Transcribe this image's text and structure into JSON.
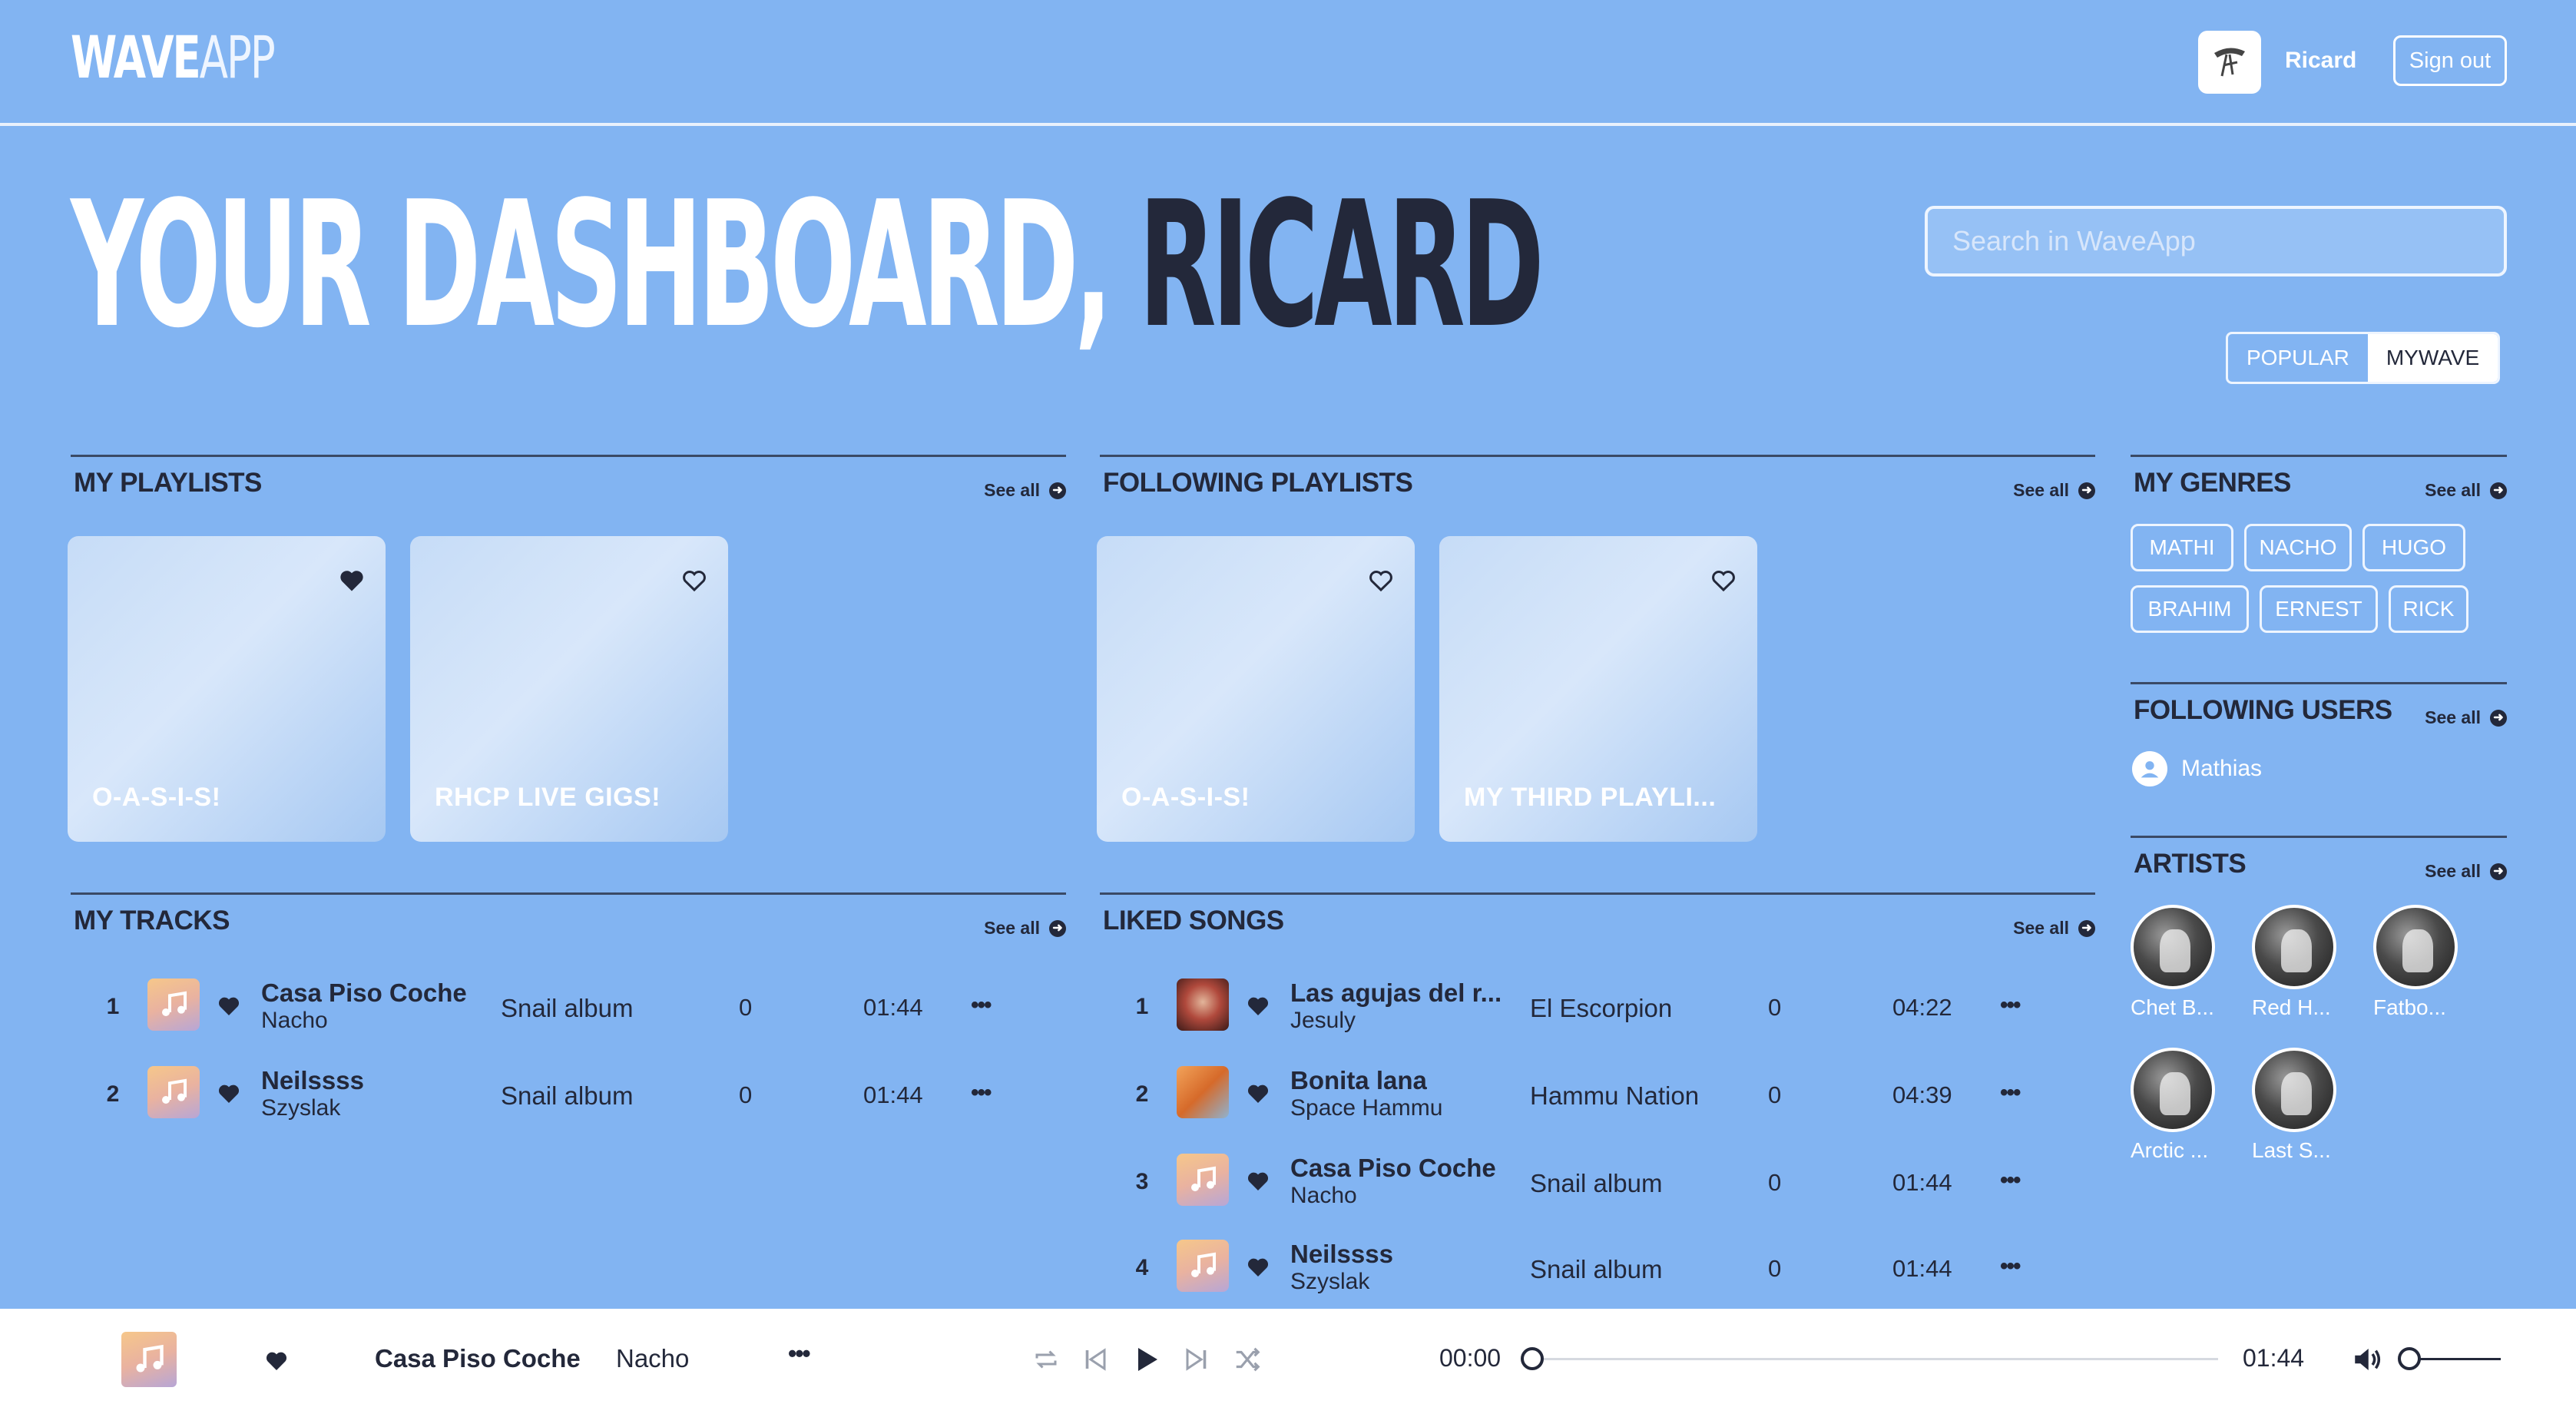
{
  "header": {
    "logo_bold": "WAVE",
    "logo_light": "APP",
    "user_name": "Ricard",
    "signout_label": "Sign out"
  },
  "hero": {
    "title_part1": "YOUR DASHBOARD, ",
    "title_part2": "RICARD"
  },
  "search": {
    "placeholder": "Search in WaveApp"
  },
  "segmented": {
    "popular": "POPULAR",
    "mywave": "MYWAVE",
    "active": "MYWAVE"
  },
  "see_all": "See all",
  "my_playlists": {
    "title": "MY PLAYLISTS",
    "items": [
      {
        "name": "O-A-S-I-S!",
        "liked": true
      },
      {
        "name": "RHCP LIVE GIGS!",
        "liked": false
      }
    ]
  },
  "following_playlists": {
    "title": "FOLLOWING PLAYLISTS",
    "items": [
      {
        "name": "O-A-S-I-S!",
        "liked": false
      },
      {
        "name": "MY THIRD PLAYLI...",
        "liked": false
      }
    ]
  },
  "my_tracks": {
    "title": "MY TRACKS",
    "rows": [
      {
        "num": "1",
        "name": "Casa Piso Coche",
        "artist": "Nacho",
        "album": "Snail album",
        "plays": "0",
        "duration": "01:44",
        "thumb": "music-note"
      },
      {
        "num": "2",
        "name": "Neilssss",
        "artist": "Szyslak",
        "album": "Snail album",
        "plays": "0",
        "duration": "01:44",
        "thumb": "music-note"
      }
    ]
  },
  "liked_songs": {
    "title": "LIKED SONGS",
    "rows": [
      {
        "num": "1",
        "name": "Las agujas del r...",
        "artist": "Jesuly",
        "album": "El Escorpion",
        "plays": "0",
        "duration": "04:22",
        "thumb": "photo-red"
      },
      {
        "num": "2",
        "name": "Bonita lana",
        "artist": "Space Hammu",
        "album": "Hammu Nation",
        "plays": "0",
        "duration": "04:39",
        "thumb": "photo-orange"
      },
      {
        "num": "3",
        "name": "Casa Piso Coche",
        "artist": "Nacho",
        "album": "Snail album",
        "plays": "0",
        "duration": "01:44",
        "thumb": "music-note"
      },
      {
        "num": "4",
        "name": "Neilssss",
        "artist": "Szyslak",
        "album": "Snail album",
        "plays": "0",
        "duration": "01:44",
        "thumb": "music-note"
      }
    ]
  },
  "my_genres": {
    "title": "MY GENRES",
    "tags": [
      "MATHI",
      "NACHO",
      "HUGO",
      "BRAHIM",
      "ERNEST",
      "RICK"
    ]
  },
  "following_users": {
    "title": "FOLLOWING USERS",
    "users": [
      "Mathias"
    ]
  },
  "artists": {
    "title": "ARTISTS",
    "items": [
      "Chet B...",
      "Red H...",
      "Fatbo...",
      "Arctic ...",
      "Last S..."
    ]
  },
  "player": {
    "title": "Casa Piso Coche",
    "artist": "Nacho",
    "current_time": "00:00",
    "total_time": "01:44",
    "progress": 0,
    "volume": 0
  },
  "colors": {
    "background": "#82b4f2",
    "dark_text": "#23283a",
    "white": "#ffffff"
  }
}
